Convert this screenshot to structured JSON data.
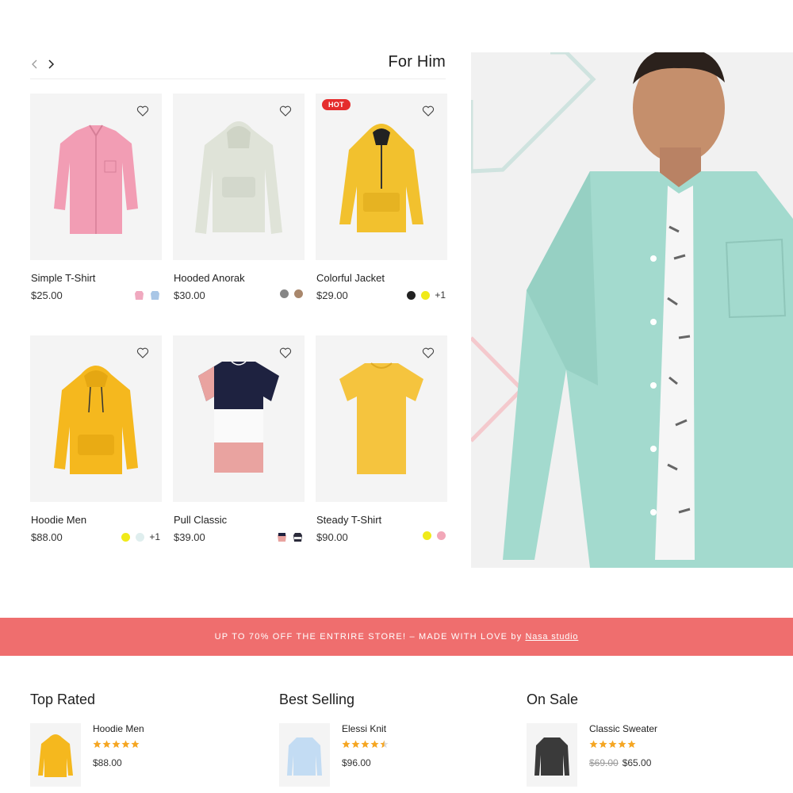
{
  "section": {
    "title": "For Him",
    "prev_icon": "chevron-left-icon",
    "next_icon": "chevron-right-icon"
  },
  "products": [
    {
      "name": "Simple T-Shirt",
      "price": "$25.00",
      "badge": "",
      "swatches": [
        "#f0a9bf",
        "#a9c6e6"
      ],
      "swatch_type": "image",
      "more": "",
      "color": "#f09ab2"
    },
    {
      "name": "Hooded Anorak",
      "price": "$30.00",
      "badge": "",
      "swatches": [
        "#858585",
        "#a9876c"
      ],
      "swatch_type": "dot",
      "more": "",
      "color": "#dfe3d8"
    },
    {
      "name": "Colorful Jacket",
      "price": "$29.00",
      "badge": "HOT",
      "swatches": [
        "#222222",
        "#f0ea1a"
      ],
      "swatch_type": "dot",
      "more": "+1",
      "color": "#f2c12e"
    },
    {
      "name": "Hoodie Men",
      "price": "$88.00",
      "badge": "",
      "swatches": [
        "#f0ea1a",
        "#dfeeee"
      ],
      "swatch_type": "dot",
      "more": "+1",
      "color": "#f5b81e"
    },
    {
      "name": "Pull Classic",
      "price": "$39.00",
      "badge": "",
      "swatches": [
        "#e9a3a0",
        "#2b2b3b"
      ],
      "swatch_type": "image",
      "more": "",
      "color": "#1e2240"
    },
    {
      "name": "Steady T-Shirt",
      "price": "$90.00",
      "badge": "",
      "swatches": [
        "#f0ea1a",
        "#f2a7b8"
      ],
      "swatch_type": "dot",
      "more": "",
      "color": "#f5c43e"
    }
  ],
  "promo": {
    "text": "UP TO 70% OFF THE ENTRIRE STORE! – MADE WITH LOVE by",
    "link": "Nasa studio"
  },
  "lists": [
    {
      "title": "Top Rated",
      "item": {
        "name": "Hoodie Men",
        "rating": 5,
        "old_price": "",
        "price": "$88.00"
      }
    },
    {
      "title": "Best Selling",
      "item": {
        "name": "Elessi Knit",
        "rating": 4.5,
        "old_price": "",
        "price": "$96.00"
      }
    },
    {
      "title": "On Sale",
      "item": {
        "name": "Classic Sweater",
        "rating": 5,
        "old_price": "$69.00",
        "price": "$65.00"
      }
    }
  ],
  "colors": {
    "accent": "#ef6e6e",
    "hot_badge": "#e52c2c",
    "star": "#f5a623",
    "card_bg": "#f4f4f4"
  }
}
